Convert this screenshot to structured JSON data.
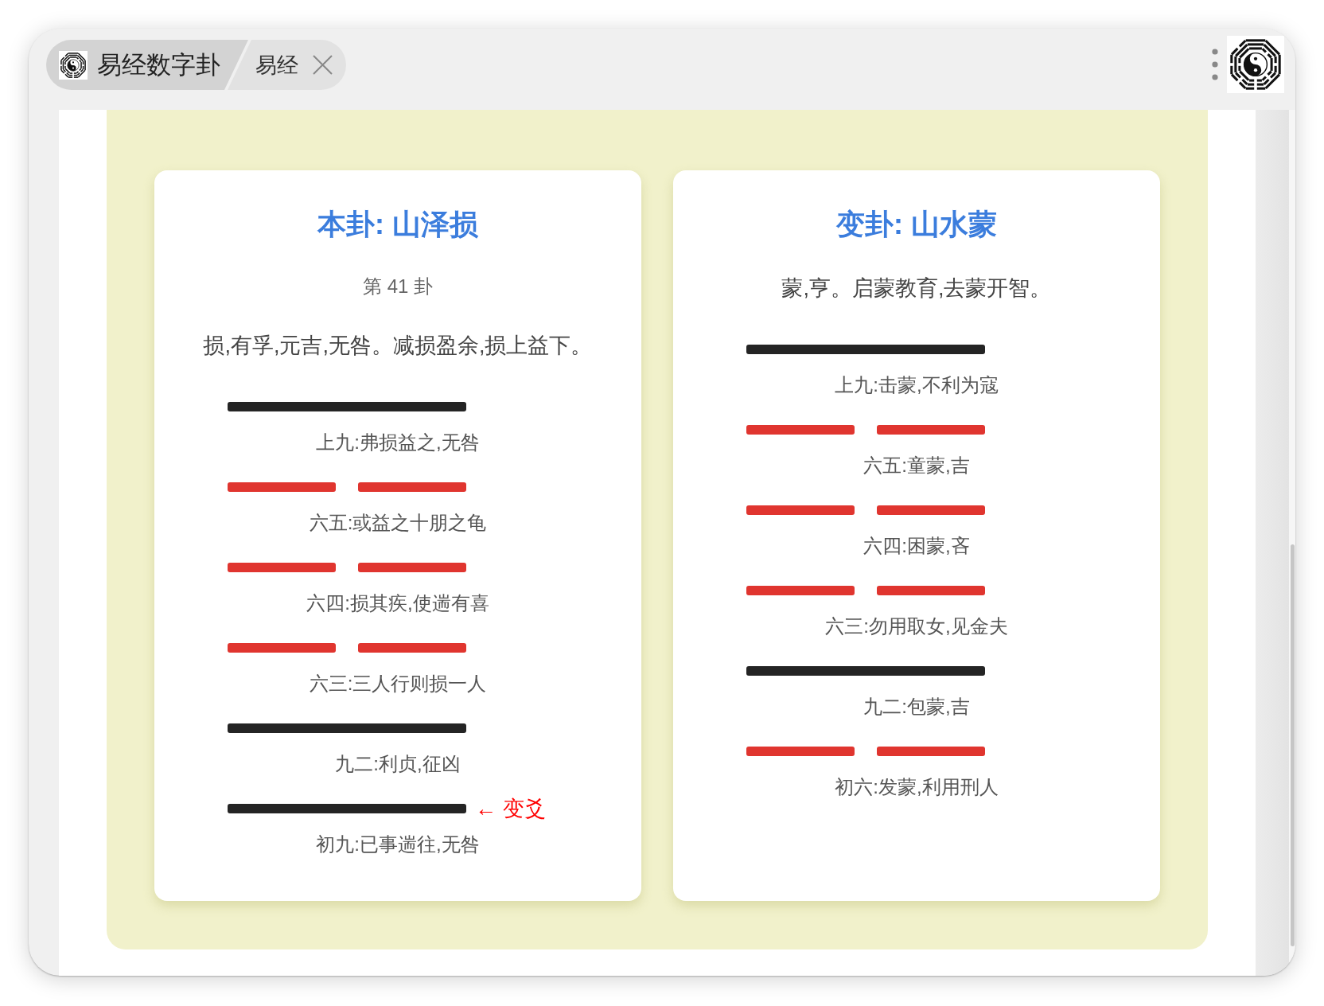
{
  "title_bar": {
    "app_title": "易经数字卦",
    "page_tab": "易经"
  },
  "cards": [
    {
      "title": "本卦: 山泽损",
      "number": "第 41 卦",
      "description": "损,有孚,元吉,无咎。减损盈余,损上益下。",
      "lines": [
        {
          "kind": "yang",
          "text": "上九:弗损益之,无咎"
        },
        {
          "kind": "yin",
          "text": "六五:或益之十朋之龟"
        },
        {
          "kind": "yin",
          "text": "六四:损其疾,使遄有喜"
        },
        {
          "kind": "yin",
          "text": "六三:三人行则损一人"
        },
        {
          "kind": "yang",
          "text": "九二:利贞,征凶"
        },
        {
          "kind": "yang",
          "text": "初九:已事遄往,无咎",
          "marker": "← 变爻"
        }
      ]
    },
    {
      "title": "变卦: 山水蒙",
      "description": "蒙,亨。启蒙教育,去蒙开智。",
      "lines": [
        {
          "kind": "yang",
          "text": "上九:击蒙,不利为寇"
        },
        {
          "kind": "yin",
          "text": "六五:童蒙,吉"
        },
        {
          "kind": "yin",
          "text": "六四:困蒙,吝"
        },
        {
          "kind": "yin",
          "text": "六三:勿用取女,见金夫"
        },
        {
          "kind": "yang",
          "text": "九二:包蒙,吉"
        },
        {
          "kind": "yin",
          "text": "初六:发蒙,利用刑人"
        }
      ]
    }
  ]
}
